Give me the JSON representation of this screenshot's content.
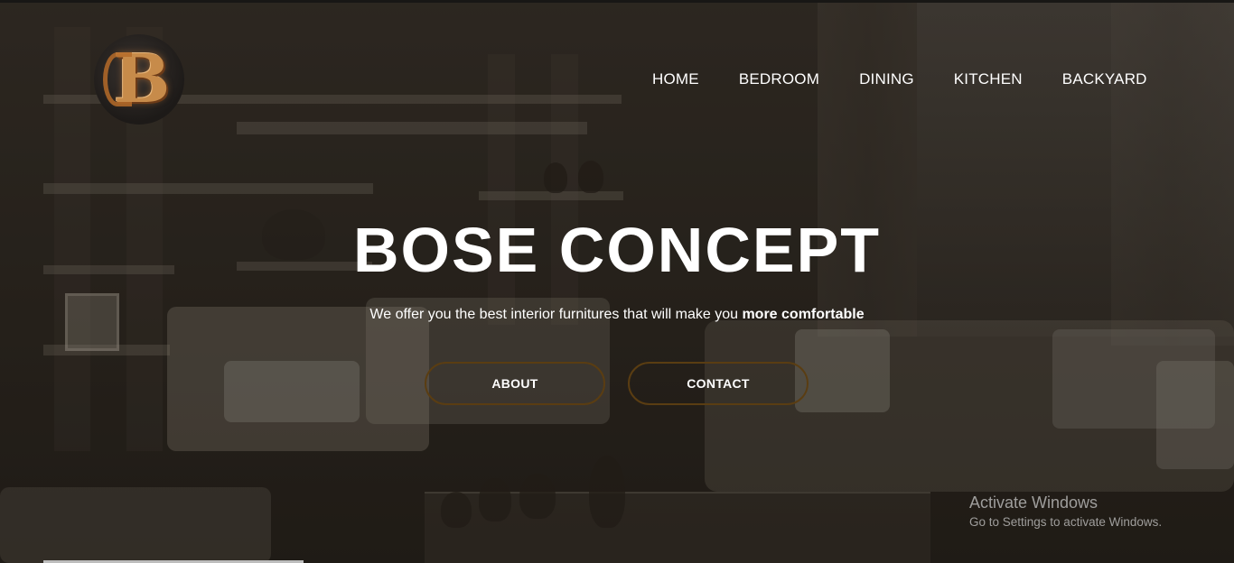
{
  "brand": {
    "logo_letter": "B",
    "accent_color": "#c78b4a"
  },
  "nav": {
    "items": [
      {
        "label": "HOME"
      },
      {
        "label": "BEDROOM"
      },
      {
        "label": "DINING"
      },
      {
        "label": "KITCHEN"
      },
      {
        "label": "BACKYARD"
      }
    ]
  },
  "hero": {
    "title": "BOSE CONCEPT",
    "subtitle_lead": "We offer you the best interior furnitures that will make you ",
    "subtitle_emphasis": "more comfortable",
    "buttons": {
      "about": "ABOUT",
      "contact": "CONTACT"
    },
    "button_border_color": "#5a3d12"
  },
  "watermark": {
    "title": "Activate Windows",
    "subtitle": "Go to Settings to activate Windows."
  }
}
